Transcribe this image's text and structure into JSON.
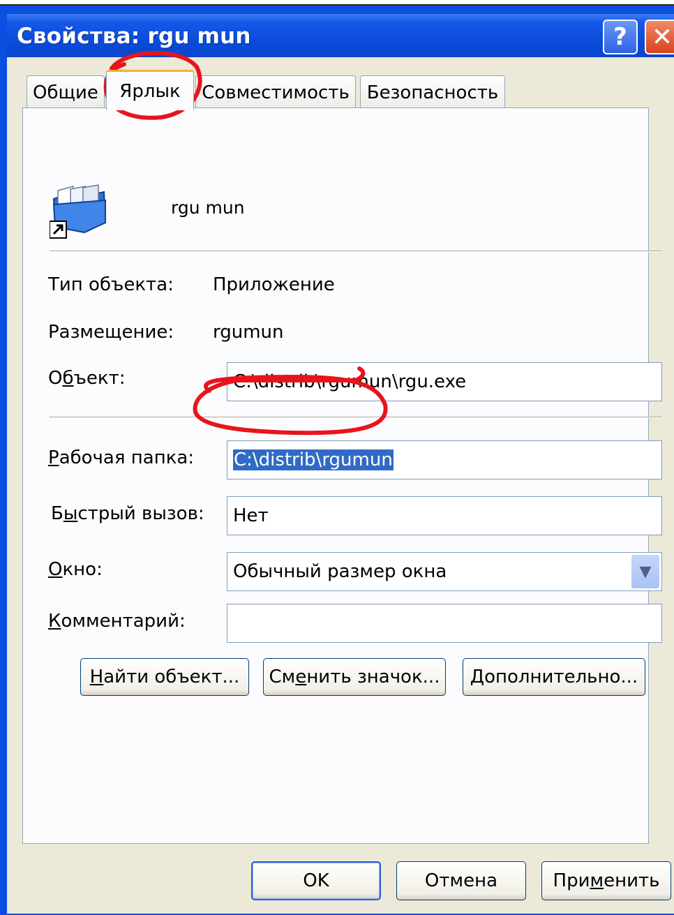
{
  "window": {
    "title": "Свойства: rgu mun"
  },
  "titlebar": {
    "help_glyph": "?",
    "close_glyph": "✕"
  },
  "tabs": [
    {
      "label": "Общие",
      "active": false
    },
    {
      "label": "Ярлык",
      "active": true
    },
    {
      "label": "Совместимость",
      "active": false
    },
    {
      "label": "Безопасность",
      "active": false
    }
  ],
  "header": {
    "object_name": "rgu mun",
    "icon": "folder-shortcut-icon"
  },
  "info": {
    "type_label": "Тип объекта:",
    "type_value": "Приложение",
    "location_label": "Размещение:",
    "location_value": "rgumun",
    "target_label_pre": "О",
    "target_label_ul": "б",
    "target_label_post": "ъект:",
    "target_value": "C:\\distrib\\rgumun\\rgu.exe"
  },
  "shortcut": {
    "workdir_label_ul": "Р",
    "workdir_label_post": "абочая папка:",
    "workdir_value": "C:\\distrib\\rgumun",
    "hotkey_label_pre": "Б",
    "hotkey_label_ul": "ы",
    "hotkey_label_post": "стрый вызов:",
    "hotkey_value": "Нет",
    "window_label_ul": "О",
    "window_label_post": "кно:",
    "window_value": "Обычный размер окна",
    "comment_label_ul": "К",
    "comment_label_post": "омментарий:",
    "comment_value": ""
  },
  "actions": {
    "find_pre": "",
    "find_ul": "Н",
    "find_post": "айти объект...",
    "change_pre": "См",
    "change_ul": "е",
    "change_post": "нить значок...",
    "advanced_pre": "",
    "advanced_ul": "Д",
    "advanced_post": "ополнительно..."
  },
  "footer": {
    "ok_label": "OK",
    "cancel_label": "Отмена",
    "apply_pre": "При",
    "apply_ul": "м",
    "apply_post": "енить"
  },
  "colors": {
    "annotation": "#e8141c",
    "selection": "#316ac5",
    "titlebar": "#0a4ad8"
  }
}
